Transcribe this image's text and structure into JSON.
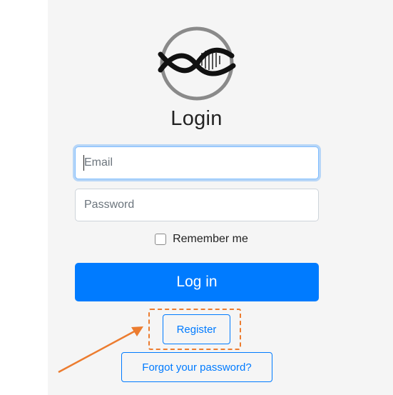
{
  "login": {
    "title": "Login",
    "email_placeholder": "Email",
    "password_placeholder": "Password",
    "remember_label": "Remember me",
    "login_button_label": "Log in",
    "register_button_label": "Register",
    "forgot_button_label": "Forgot your password?"
  },
  "logo": {
    "icon": "dna-helix-logo-icon"
  },
  "annotation": {
    "icon": "arrow-icon",
    "color": "#ec7c2f"
  },
  "colors": {
    "primary": "#007bff",
    "panel_background": "#f5f5f5",
    "highlight": "#ec7c2f"
  }
}
